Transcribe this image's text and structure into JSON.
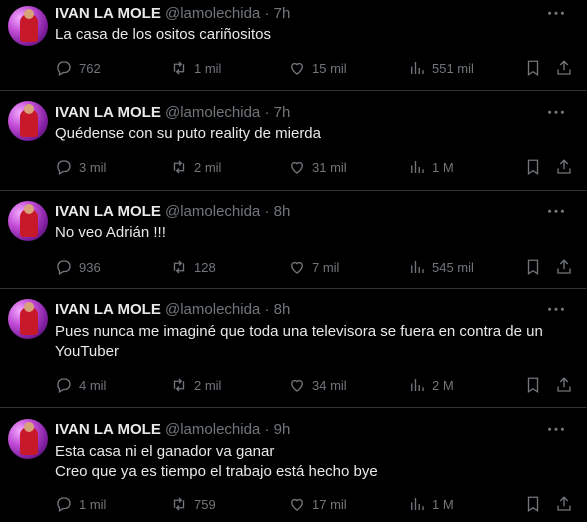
{
  "tweets": [
    {
      "name": "IVAN LA MOLE",
      "handle": "@lamolechida",
      "separator": "·",
      "time": "7h",
      "lines": [
        "La casa de los ositos cariñositos"
      ],
      "replies": "762",
      "retweets": "1 mil",
      "likes": "15 mil",
      "views": "551 mil"
    },
    {
      "name": "IVAN LA MOLE",
      "handle": "@lamolechida",
      "separator": "·",
      "time": "7h",
      "lines": [
        "Quédense con su puto reality de mierda"
      ],
      "replies": "3 mil",
      "retweets": "2 mil",
      "likes": "31 mil",
      "views": "1 M"
    },
    {
      "name": "IVAN LA MOLE",
      "handle": "@lamolechida",
      "separator": "·",
      "time": "8h",
      "lines": [
        "No veo Adrián !!!"
      ],
      "replies": "936",
      "retweets": "128",
      "likes": "7 mil",
      "views": "545 mil"
    },
    {
      "name": "IVAN LA MOLE",
      "handle": "@lamolechida",
      "separator": "·",
      "time": "8h",
      "lines": [
        "Pues nunca me imaginé que toda una televisora se fuera en contra de un",
        "YouTuber"
      ],
      "replies": "4 mil",
      "retweets": "2 mil",
      "likes": "34 mil",
      "views": "2 M"
    },
    {
      "name": "IVAN LA MOLE",
      "handle": "@lamolechida",
      "separator": "·",
      "time": "9h",
      "lines": [
        "Esta casa ni el ganador va ganar",
        "Creo que ya es tiempo el trabajo está hecho bye"
      ],
      "replies": "1 mil",
      "retweets": "759",
      "likes": "17 mil",
      "views": "1 M"
    }
  ],
  "icons": {
    "more": "more-icon",
    "reply": "reply-icon",
    "retweet": "retweet-icon",
    "like": "heart-icon",
    "views": "views-icon",
    "bookmark": "bookmark-icon",
    "share": "share-icon"
  },
  "colors": {
    "background": "#000000",
    "text": "#e7e9ea",
    "secondary": "#71767b",
    "divider": "#2f3336"
  }
}
